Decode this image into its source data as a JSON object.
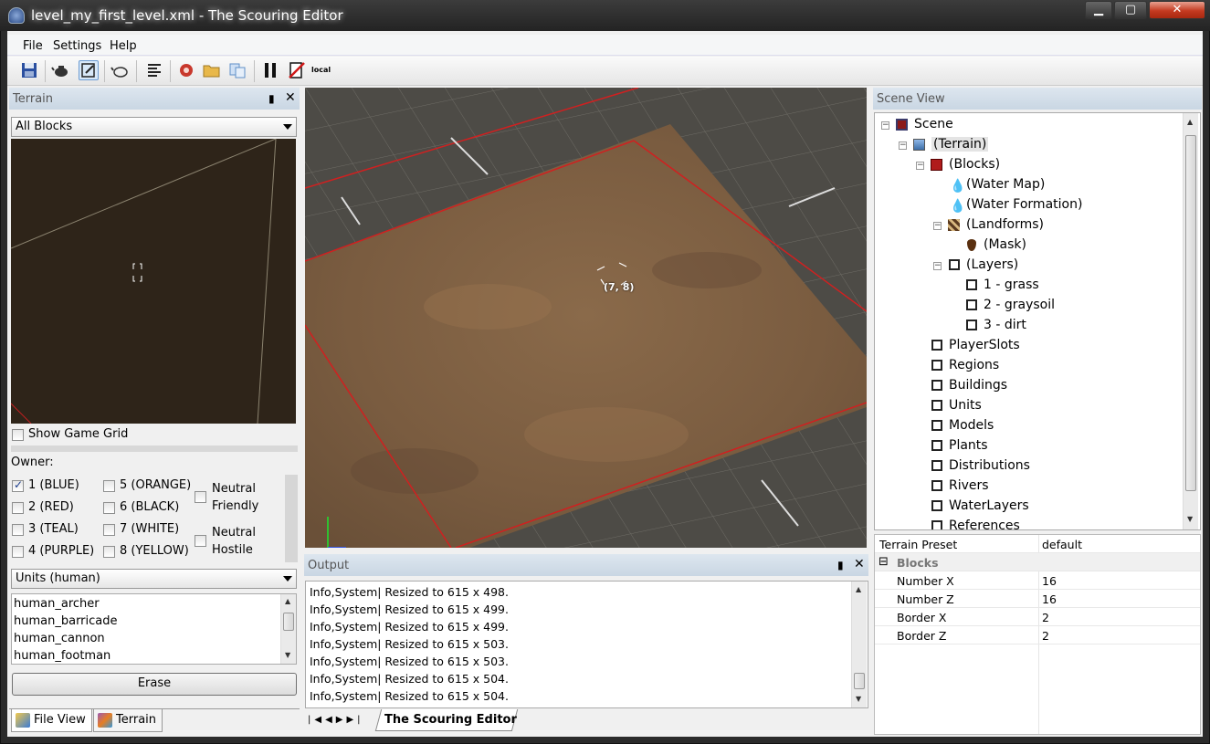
{
  "window": {
    "title": "level_my_first_level.xml - The Scouring Editor",
    "min_icon": "minimize-icon",
    "max_icon": "maximize-icon",
    "close_icon": "close-icon"
  },
  "menu": {
    "items": [
      "File",
      "Settings",
      "Help"
    ]
  },
  "toolbar": {
    "buttons": [
      "save-icon",
      "teapot-icon",
      "edit-icon",
      "teapot-outline-icon",
      "align-icon",
      "refresh-icon",
      "open-folder-icon",
      "copy-icon",
      "pause-icon",
      "stop-icon",
      "local-icon"
    ],
    "local_label": "local"
  },
  "terrain_panel": {
    "title": "Terrain",
    "pin_glyph": "▮",
    "close_glyph": "✕",
    "block_combo": "All Blocks",
    "show_grid_label": "Show Game Grid",
    "owner_label": "Owner:",
    "owners": [
      {
        "label": "1 (BLUE)",
        "checked": true
      },
      {
        "label": "2 (RED)",
        "checked": false
      },
      {
        "label": "3 (TEAL)",
        "checked": false
      },
      {
        "label": "4 (PURPLE)",
        "checked": false
      },
      {
        "label": "5 (ORANGE)",
        "checked": false
      },
      {
        "label": "6 (BLACK)",
        "checked": false
      },
      {
        "label": "7 (WHITE)",
        "checked": false
      },
      {
        "label": "8 (YELLOW)",
        "checked": false
      }
    ],
    "neutral_friendly": [
      "Neutral",
      "Friendly"
    ],
    "neutral_hostile": [
      "Neutral",
      "Hostile"
    ],
    "units_combo": "Units (human)",
    "units": [
      "human_archer",
      "human_barricade",
      "human_cannon",
      "human_footman"
    ],
    "erase_label": "Erase"
  },
  "bottom_tabs": [
    "File View",
    "Terrain"
  ],
  "viewport": {
    "cursor_label": "(7, 8)"
  },
  "output_panel": {
    "title": "Output",
    "lines": [
      "Info,System| Resized to 615 x 498.",
      "Info,System| Resized to 615 x 499.",
      "Info,System| Resized to 615 x 499.",
      "Info,System| Resized to 615 x 503.",
      "Info,System| Resized to 615 x 503.",
      "Info,System| Resized to 615 x 504.",
      "Info,System| Resized to 615 x 504."
    ],
    "nav_glyphs": [
      "|◀",
      "◀",
      "▶",
      "▶|"
    ],
    "doc_tab": "The Scouring Editor"
  },
  "scene_panel": {
    "title": "Scene View",
    "tree": {
      "scene": "Scene",
      "terrain": "(Terrain)",
      "blocks": "(Blocks)",
      "water_map": "(Water Map)",
      "water_formation": "(Water Formation)",
      "landforms": "(Landforms)",
      "mask": "(Mask)",
      "layers": "(Layers)",
      "layer_items": [
        "1 - grass",
        "2 - graysoil",
        "3 - dirt"
      ],
      "top_items": [
        "PlayerSlots",
        "Regions",
        "Buildings",
        "Units",
        "Models",
        "Plants",
        "Distributions",
        "Rivers",
        "WaterLayers",
        "References"
      ]
    }
  },
  "properties": {
    "preset_key": "Terrain Preset",
    "preset_val": "default",
    "group": "Blocks",
    "group_toggle": "⊟",
    "rows": [
      {
        "key": "Number X",
        "val": "16"
      },
      {
        "key": "Number Z",
        "val": "16"
      },
      {
        "key": "Border X",
        "val": "2"
      },
      {
        "key": "Border Z",
        "val": "2"
      }
    ]
  }
}
